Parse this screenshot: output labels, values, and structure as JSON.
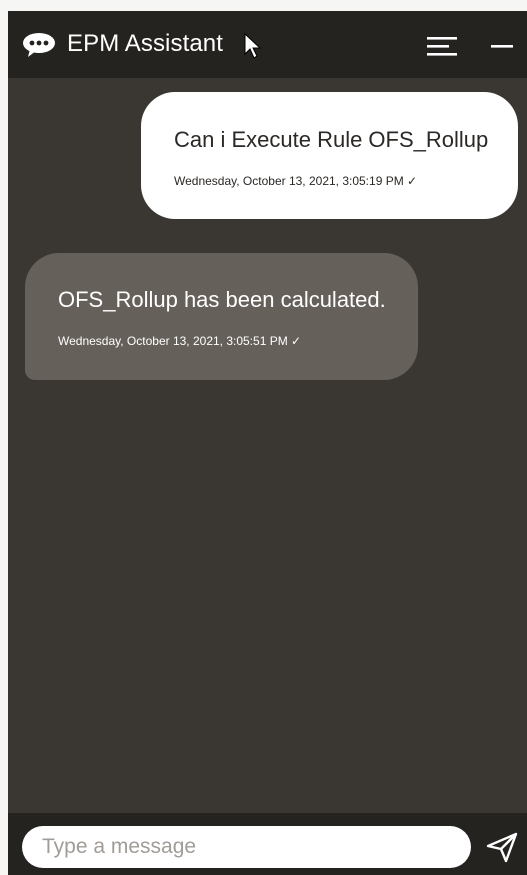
{
  "header": {
    "title": "EPM Assistant",
    "icons": [
      "chat-bubble-icon",
      "menu-icon",
      "minimize-icon"
    ]
  },
  "messages": [
    {
      "sender": "user",
      "text": "Can i Execute Rule OFS_Rollup",
      "timestamp": "Wednesday, October 13, 2021, 3:05:19 PM ✓"
    },
    {
      "sender": "bot",
      "text": "OFS_Rollup has been calculated.",
      "timestamp": "Wednesday, October 13, 2021, 3:05:51 PM ✓"
    }
  ],
  "composer": {
    "placeholder": "Type a message",
    "value": "",
    "send_icon": "send-icon"
  },
  "colors": {
    "header_bg": "#252320",
    "chat_bg": "#3a3631",
    "user_bubble": "#ffffff",
    "bot_bubble": "#66605b",
    "text_light": "#ffffff",
    "text_dark": "#2b2825"
  }
}
